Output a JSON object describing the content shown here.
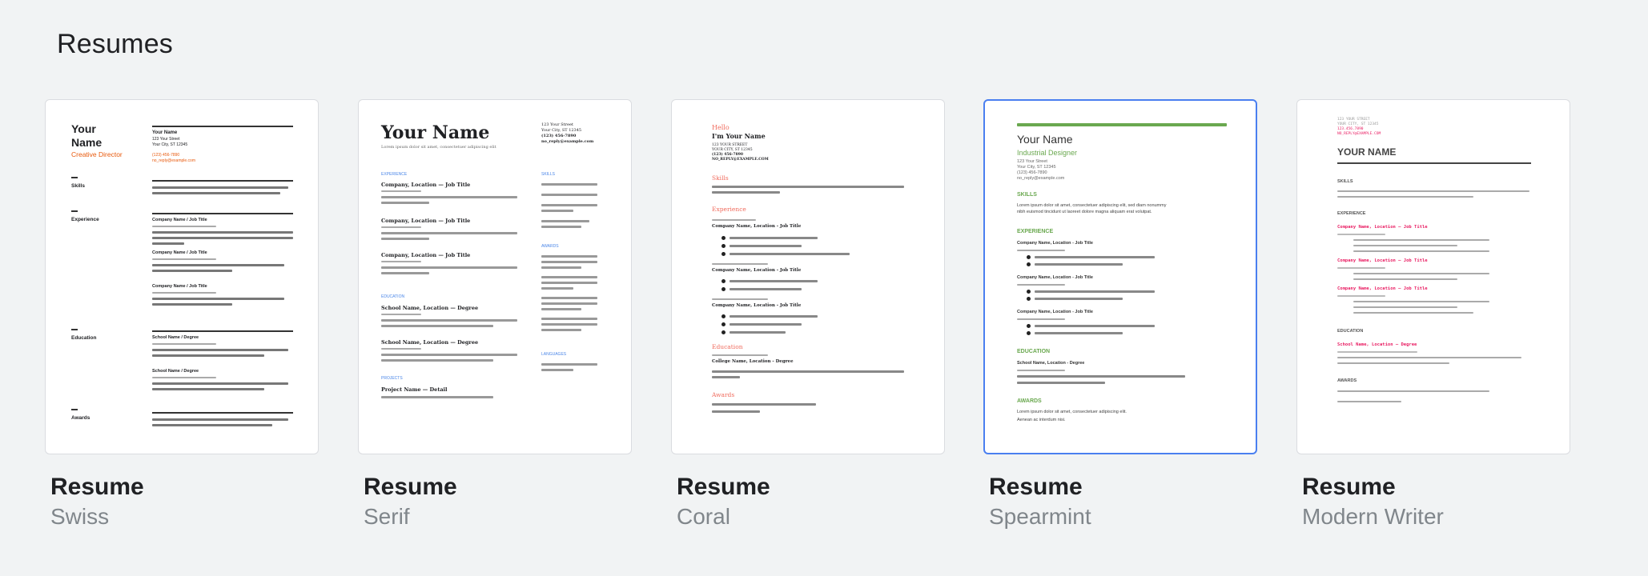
{
  "section": {
    "title": "Resumes"
  },
  "templates": [
    {
      "title": "Resume",
      "subtitle": "Swiss",
      "preview": {
        "name_line1": "Your",
        "name_line2": "Name",
        "role": "Creative Director",
        "contact_name": "Your Name",
        "addr1": "123 Your Street",
        "addr2": "Your City, ST 12345",
        "phone": "(123) 456-7890",
        "email": "no_reply@example.com",
        "skills": "Skills",
        "experience": "Experience",
        "education": "Education",
        "awards": "Awards",
        "job1": "Company Name / Job Title",
        "job2": "Company Name / Job Title",
        "job3": "Company Name / Job Title",
        "school1": "School Name / Degree",
        "school2": "School Name / Degree"
      }
    },
    {
      "title": "Resume",
      "subtitle": "Serif",
      "preview": {
        "name": "Your Name",
        "tagline": "Lorem ipsum dolor sit amet, consectetuer adipiscing elit",
        "addr1": "123 Your Street",
        "addr2": "Your City, ST 12345",
        "phone": "(123) 456-7890",
        "email": "no_reply@example.com",
        "experience": "EXPERIENCE",
        "skills": "SKILLS",
        "awards": "AWARDS",
        "education": "EDUCATION",
        "projects": "PROJECTS",
        "languages": "LANGUAGES",
        "job1": "Company, Location — Job Title",
        "job2": "Company, Location — Job Title",
        "job3": "Company, Location — Job Title",
        "school1": "School Name, Location — Degree",
        "school2": "School Name, Location — Degree",
        "project": "Project Name — Detail"
      }
    },
    {
      "title": "Resume",
      "subtitle": "Coral",
      "preview": {
        "hello": "Hello",
        "name": "I'm Your Name",
        "addr1": "123 YOUR STREET",
        "addr2": "YOUR CITY, ST 12345",
        "phone": "(123) 456-7890",
        "email": "NO_REPLY@EXAMPLE.COM",
        "skills": "Skills",
        "experience": "Experience",
        "education": "Education",
        "awards": "Awards",
        "job1": "Company Name, Location - Job Title",
        "job2": "Company Name, Location - Job Title",
        "job3": "Company Name, Location - Job Title",
        "school": "College Name, Location - Degree"
      }
    },
    {
      "title": "Resume",
      "subtitle": "Spearmint",
      "preview": {
        "name": "Your Name",
        "role": "Industrial Designer",
        "addr1": "123 Your Street",
        "addr2": "Your City, ST 12345",
        "phone": "(123) 456-7890",
        "email": "no_reply@example.com",
        "skills": "SKILLS",
        "experience": "EXPERIENCE",
        "education": "EDUCATION",
        "awards": "AWARDS",
        "job1": "Company Name, Location - Job Title",
        "job2": "Company Name, Location - Job Title",
        "job3": "Company Name, Location - Job Title",
        "school": "School Name, Location - Degree",
        "lorem1": "Lorem ipsum dolor sit amet, consectetuer adipiscing elit, sed diam nonummy",
        "lorem2": "nibh euismod tincidunt ut laoreet dolore magna aliquam erat volutpat.",
        "lorem3": "Lorem ipsum dolor sit amet, consectetuer adipiscing elit.",
        "lorem4": "Aenean ac interdum nisi."
      }
    },
    {
      "title": "Resume",
      "subtitle": "Modern Writer",
      "preview": {
        "addr1": "123 YOUR STREET",
        "addr2": "YOUR CITY, ST 12345",
        "phone": "123.456.7890",
        "email": "NO_REPLY@EXAMPLE.COM",
        "name": "YOUR NAME",
        "skills": "SKILLS",
        "experience": "EXPERIENCE",
        "education": "EDUCATION",
        "awards": "AWARDS",
        "job1": "Company Name, Location — Job Title",
        "job2": "Company Name, Location — Job Title",
        "job3": "Company Name, Location — Job Title",
        "school": "School Name, Location — Degree"
      }
    }
  ],
  "colors": {
    "accent_selected": "#4a7ff0",
    "swiss_orange": "#e8590c",
    "serif_blue": "#4a86e8",
    "coral": "#f06b5d",
    "spearmint": "#6aa84f",
    "writer_pink": "#e91e63"
  }
}
